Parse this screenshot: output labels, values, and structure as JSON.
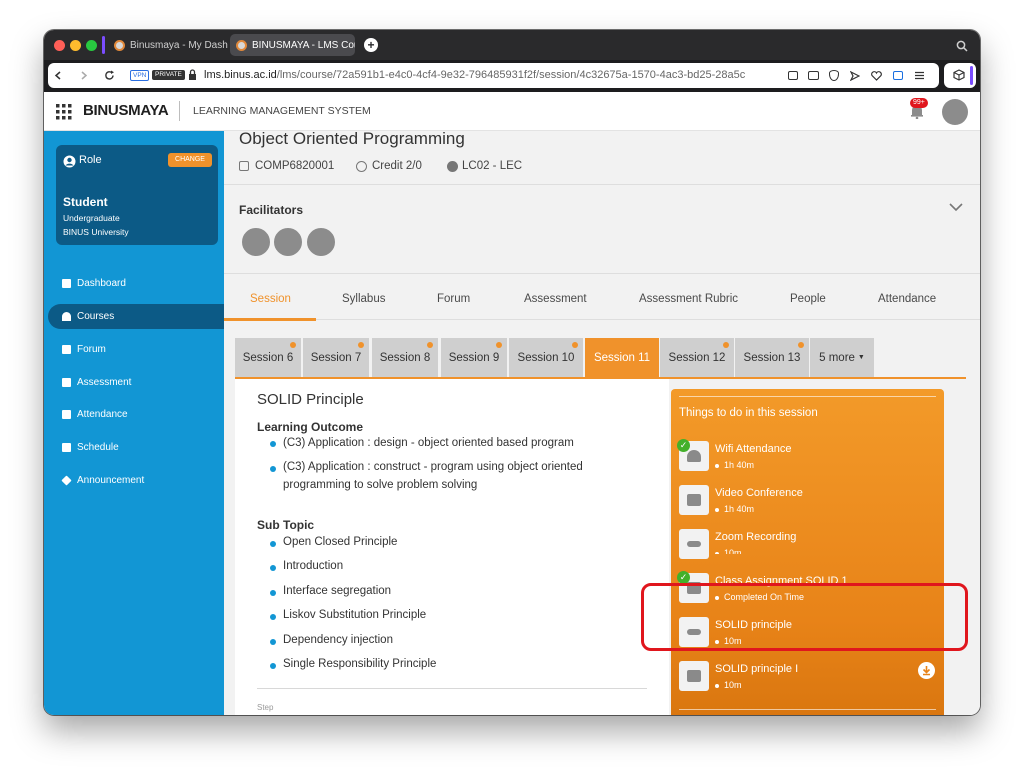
{
  "browser": {
    "tabs": [
      {
        "title": "Binusmaya - My Dashbo"
      },
      {
        "title": "BINUSMAYA - LMS Cour"
      }
    ],
    "new_tab": "+",
    "url_host": "lms.binus.ac.id",
    "url_path": "/lms/course/72a591b1-e4c0-4cf4-9e32-796485931f2f/session/4c32675a-1570-4ac3-bd25-28a5c",
    "vpn_badge": "VPN",
    "private_badge": "PRIVATE"
  },
  "header": {
    "logo": "BINUSMAYA",
    "app_name": "LEARNING MANAGEMENT SYSTEM",
    "notification_count": "99+"
  },
  "sidebar": {
    "role_label": "Role",
    "change_button": "CHANGE",
    "role_name": "Student",
    "role_level": "Undergraduate",
    "role_org": "BINUS University",
    "items": [
      {
        "label": "Dashboard",
        "icon": "dashboard-icon"
      },
      {
        "label": "Courses",
        "icon": "courses-icon",
        "active": true
      },
      {
        "label": "Forum",
        "icon": "forum-icon"
      },
      {
        "label": "Assessment",
        "icon": "assessment-icon"
      },
      {
        "label": "Attendance",
        "icon": "attendance-icon"
      },
      {
        "label": "Schedule",
        "icon": "schedule-icon"
      },
      {
        "label": "Announcement",
        "icon": "announcement-icon"
      }
    ]
  },
  "course": {
    "title": "Object Oriented Programming",
    "code": "COMP6820001",
    "credit": "Credit 2/0",
    "class": "LC02 - LEC",
    "facilitators_label": "Facilitators"
  },
  "course_tabs": [
    "Session",
    "Syllabus",
    "Forum",
    "Assessment",
    "Assessment Rubric",
    "People",
    "Attendance"
  ],
  "session_tabs": [
    "Session 6",
    "Session 7",
    "Session 8",
    "Session 9",
    "Session 10",
    "Session 11",
    "Session 12",
    "Session 13"
  ],
  "more_sessions": "5 more",
  "session": {
    "title": "SOLID Principle",
    "learning_outcome_label": "Learning Outcome",
    "learning_outcomes": [
      "(C3) Application : design - object oriented based program",
      "(C3) Application : construct - program using object oriented programming to solve problem solving"
    ],
    "sub_topic_label": "Sub Topic",
    "sub_topics": [
      "Open Closed Principle",
      "Introduction",
      "Interface segregation",
      "Liskov Substitution Principle",
      "Dependency injection",
      "Single Responsibility Principle"
    ],
    "cutoff_text": "Step"
  },
  "todo": {
    "title": "Things to do in this session",
    "items": [
      {
        "title": "Wifi Attendance",
        "sub": "1h 40m",
        "icon": "wifi-icon",
        "done": true
      },
      {
        "title": "Video Conference",
        "sub": "1h 40m",
        "icon": "video-icon",
        "done": false
      },
      {
        "title": "Zoom Recording",
        "sub": "10m",
        "icon": "link-icon",
        "done": false
      },
      {
        "title": "Class Assignment SOLID 1",
        "sub": "Completed On Time",
        "icon": "document-icon",
        "done": true
      },
      {
        "title": "SOLID principle",
        "sub": "10m",
        "icon": "link-icon",
        "done": false
      },
      {
        "title": "SOLID principle I",
        "sub": "10m",
        "icon": "book-icon",
        "done": false
      }
    ]
  },
  "colors": {
    "sidebar_blue": "#1296d4",
    "role_card": "#0c5a86",
    "accent_orange": "#f0922b",
    "highlight_red": "#e0161d"
  }
}
